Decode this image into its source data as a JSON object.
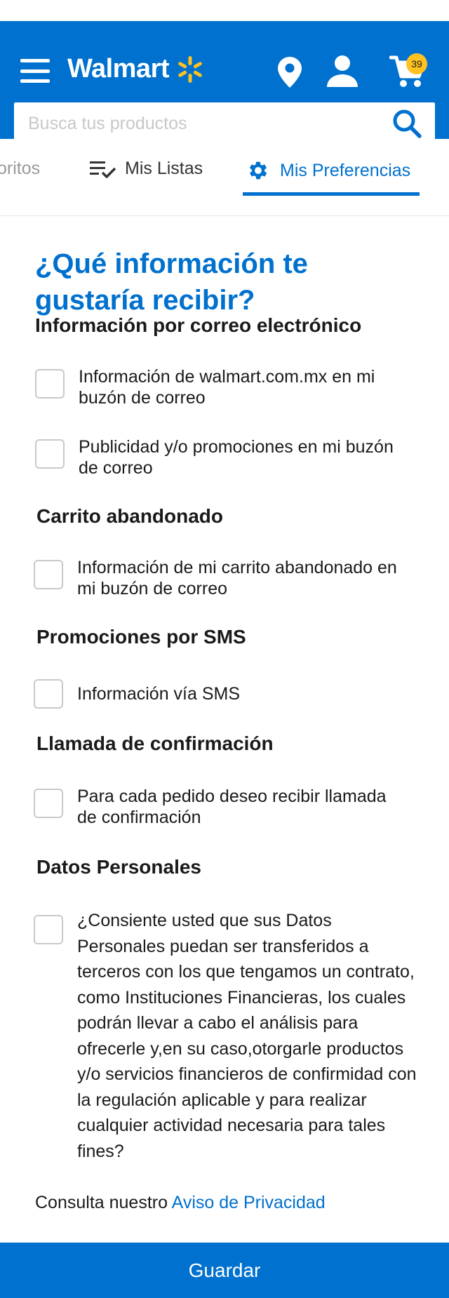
{
  "header": {
    "brand_name": "Walmart",
    "cart_count": "39",
    "colors": {
      "bar": "#0071ce",
      "spark": "#ffc220",
      "badge": "#ffc220"
    },
    "icons": [
      "menu-icon",
      "spark-icon",
      "location-pin-icon",
      "user-icon",
      "cart-icon",
      "search-icon"
    ]
  },
  "search": {
    "placeholder": "Busca tus productos",
    "value": ""
  },
  "tabs": [
    {
      "label": "oritos",
      "icon": null,
      "active": false
    },
    {
      "label": "Mis Listas",
      "icon": "list-check-icon",
      "active": false
    },
    {
      "label": "Mis Preferencias",
      "icon": "gear-icon",
      "active": true
    }
  ],
  "main": {
    "title": "¿Qué información te gustaría recibir?",
    "sections": [
      {
        "title": "Información por correo electrónico",
        "options": [
          {
            "label": "Información de walmart.com.mx en mi buzón de correo",
            "checked": false
          },
          {
            "label": "Publicidad y/o promociones en mi buzón de correo",
            "checked": false
          }
        ]
      },
      {
        "title": "Carrito abandonado",
        "options": [
          {
            "label": "Información de mi carrito abandonado en mi buzón de correo",
            "checked": false
          }
        ]
      },
      {
        "title": "Promociones por SMS",
        "options": [
          {
            "label": "Información vía SMS",
            "checked": false
          }
        ]
      },
      {
        "title": "Llamada de confirmación",
        "options": [
          {
            "label": "Para cada pedido deseo recibir llamada de confirmación",
            "checked": false
          }
        ]
      },
      {
        "title": "Datos Personales",
        "options": [
          {
            "label": "¿Consiente usted que sus Datos Personales puedan ser transferidos a terceros con los que tengamos un contrato, como Instituciones Financieras, los cuales podrán llevar a cabo el análisis para ofrecerle y,en su caso,otorgarle productos y/o servicios financieros de confirmidad con la regulación aplicable y para realizar cualquier actividad necesaria para tales fines?",
            "checked": false
          }
        ]
      }
    ],
    "privacy_prefix": "Consulta nuestro",
    "privacy_link": "Aviso de Privacidad"
  },
  "footer": {
    "save_label": "Guardar"
  }
}
